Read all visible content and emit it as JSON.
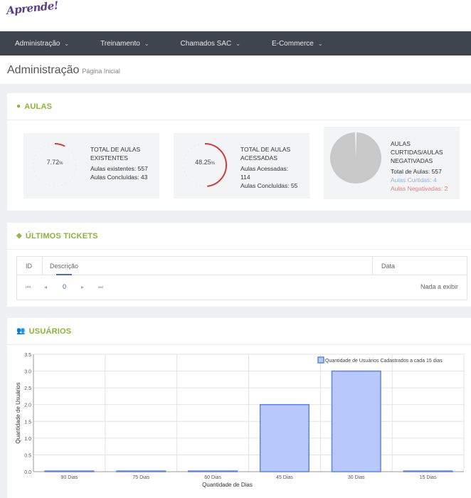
{
  "app": {
    "logo_text": "Aprende!"
  },
  "nav": {
    "items": [
      {
        "label": "Administração"
      },
      {
        "label": "Treinamento"
      },
      {
        "label": "Chamados SAC"
      },
      {
        "label": "E-Commerce"
      }
    ]
  },
  "page": {
    "title": "Administração",
    "subtitle": "Página Inicial"
  },
  "aulas": {
    "title": "AULAS",
    "cards": [
      {
        "gauge_value": "7.72",
        "gauge_unit": "%",
        "gauge_fraction": 0.0772,
        "title_line1": "TOTAL DE AULAS",
        "title_line2": "EXISTENTES",
        "line1": "Aulas existentes: 557",
        "line2": "Aulas Concluídas: 43"
      },
      {
        "gauge_value": "48.25",
        "gauge_unit": "%",
        "gauge_fraction": 0.4825,
        "title_line1": "TOTAL DE AULAS",
        "title_line2": "ACESSADAS",
        "line1": "Aulas Acessadas:",
        "line1b": "114",
        "line2": "Aulas Concluídas: 55"
      },
      {
        "title_line1": "AULAS",
        "title_line2": "CURTIDAS/AULAS",
        "title_line3": "NEGATIVADAS",
        "line1": "Total de Aulas: 557",
        "line2": "Aulas Curtidas: 4",
        "line3": "Aulas Negativadas: 2",
        "colors": {
          "curtidas": "#8fb3e8",
          "negativadas": "#e87f7f"
        }
      }
    ]
  },
  "tickets": {
    "title": "ÚLTIMOS TICKETS",
    "columns": [
      "ID",
      "Descrição",
      "Data"
    ],
    "pager": {
      "current_page": "0",
      "empty_text": "Nada a exibir"
    }
  },
  "usuarios": {
    "title": "USUÁRIOS",
    "chart_data": {
      "type": "bar",
      "categories": [
        "90 Dias",
        "75 Dias",
        "60 Dias",
        "45 Dias",
        "30 Dias",
        "15 Dias"
      ],
      "series": [
        {
          "name": "Quantidade de Usuários Cadastrados a cada 15 dias",
          "values": [
            0,
            0,
            0,
            2,
            3,
            0
          ]
        }
      ],
      "xlabel": "Quantidade de Dias",
      "ylabel": "Quantidade de Usuários",
      "ylim": [
        0,
        3.5
      ],
      "yticks": [
        "0.0",
        "0.5",
        "1.0",
        "1.5",
        "2.0",
        "2.5",
        "3.0",
        "3.5"
      ],
      "grid": true,
      "legend": "top-right",
      "colors": {
        "bar_fill": "#b9c8fb",
        "bar_stroke": "#5b86e8"
      }
    }
  },
  "colors": {
    "accent": "#8bb240",
    "navbar": "#3e454f",
    "gauge_red": "#d23c3c"
  }
}
